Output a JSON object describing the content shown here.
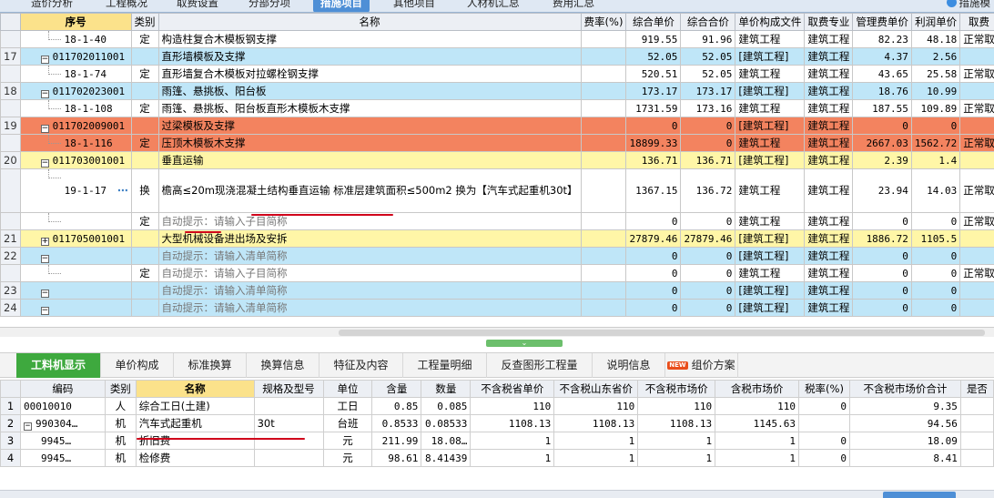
{
  "top_tabs": [
    "造价分析",
    "工程概况",
    "取费设置",
    "分部分项",
    "措施项目",
    "其他项目",
    "人材机汇总",
    "费用汇总"
  ],
  "top_tab_active": 4,
  "top_right_label": "措施模",
  "grid": {
    "headers": [
      "",
      "序号",
      "类别",
      "名称",
      "费率(%)",
      "综合单价",
      "综合合价",
      "单价构成文件",
      "取费专业",
      "管理费单价",
      "利润单价",
      "取费"
    ],
    "rows": [
      {
        "rn": "",
        "code": "18-1-40",
        "type": "定",
        "name": "构造柱复合木模板钢支撑",
        "rate": "",
        "unit_price": "919.55",
        "total": "91.96",
        "doc": "建筑工程",
        "spec": "建筑工程",
        "mgmt": "82.23",
        "profit": "48.18",
        "fee": "正常取"
      },
      {
        "rn": "17",
        "code": "011702011001",
        "type": "",
        "name": "直形墙模板及支撑",
        "rate": "",
        "unit_price": "52.05",
        "total": "52.05",
        "doc": "[建筑工程]",
        "spec": "建筑工程",
        "mgmt": "4.37",
        "profit": "2.56",
        "fee": ""
      },
      {
        "rn": "",
        "code": "18-1-74",
        "type": "定",
        "name": "直形墙复合木模板对拉螺栓钢支撑",
        "rate": "",
        "unit_price": "520.51",
        "total": "52.05",
        "doc": "建筑工程",
        "spec": "建筑工程",
        "mgmt": "43.65",
        "profit": "25.58",
        "fee": "正常取"
      },
      {
        "rn": "18",
        "code": "011702023001",
        "type": "",
        "name": "雨篷、悬挑板、阳台板",
        "rate": "",
        "unit_price": "173.17",
        "total": "173.17",
        "doc": "[建筑工程]",
        "spec": "建筑工程",
        "mgmt": "18.76",
        "profit": "10.99",
        "fee": ""
      },
      {
        "rn": "",
        "code": "18-1-108",
        "type": "定",
        "name": "雨篷、悬挑板、阳台板直形木模板木支撑",
        "rate": "",
        "unit_price": "1731.59",
        "total": "173.16",
        "doc": "建筑工程",
        "spec": "建筑工程",
        "mgmt": "187.55",
        "profit": "109.89",
        "fee": "正常取"
      },
      {
        "rn": "19",
        "code": "011702009001",
        "type": "",
        "name": "过梁模板及支撑",
        "rate": "",
        "unit_price": "0",
        "total": "0",
        "doc": "[建筑工程]",
        "spec": "建筑工程",
        "mgmt": "0",
        "profit": "0",
        "fee": ""
      },
      {
        "rn": "",
        "code": "18-1-116",
        "type": "定",
        "name": "压顶木模板木支撑",
        "rate": "",
        "unit_price": "18899.33",
        "total": "0",
        "doc": "建筑工程",
        "spec": "建筑工程",
        "mgmt": "2667.03",
        "profit": "1562.72",
        "fee": "正常取"
      },
      {
        "rn": "20",
        "code": "011703001001",
        "type": "",
        "name": "垂直运输",
        "rate": "",
        "unit_price": "136.71",
        "total": "136.71",
        "doc": "[建筑工程]",
        "spec": "建筑工程",
        "mgmt": "2.39",
        "profit": "1.4",
        "fee": ""
      },
      {
        "rn": "",
        "code": "19-1-17",
        "type": "换",
        "name": "檐高≤20m现浇混凝土结构垂直运输 标准层建筑面积≤500m2  换为【汽车式起重机30t】",
        "rate": "",
        "unit_price": "1367.15",
        "total": "136.72",
        "doc": "建筑工程",
        "spec": "建筑工程",
        "mgmt": "23.94",
        "profit": "14.03",
        "fee": "正常取"
      },
      {
        "rn": "",
        "code": "",
        "type": "定",
        "name": "自动提示：请输入子目简称",
        "rate": "",
        "unit_price": "0",
        "total": "0",
        "doc": "建筑工程",
        "spec": "建筑工程",
        "mgmt": "0",
        "profit": "0",
        "fee": "正常取"
      },
      {
        "rn": "21",
        "code": "011705001001",
        "type": "",
        "name": "大型机械设备进出场及安拆",
        "rate": "",
        "unit_price": "27879.46",
        "total": "27879.46",
        "doc": "[建筑工程]",
        "spec": "建筑工程",
        "mgmt": "1886.72",
        "profit": "1105.5",
        "fee": ""
      },
      {
        "rn": "22",
        "code": "",
        "type": "",
        "name": "自动提示：请输入清单简称",
        "rate": "",
        "unit_price": "0",
        "total": "0",
        "doc": "[建筑工程]",
        "spec": "建筑工程",
        "mgmt": "0",
        "profit": "0",
        "fee": ""
      },
      {
        "rn": "",
        "code": "",
        "type": "定",
        "name": "自动提示：请输入子目简称",
        "rate": "",
        "unit_price": "0",
        "total": "0",
        "doc": "建筑工程",
        "spec": "建筑工程",
        "mgmt": "0",
        "profit": "0",
        "fee": "正常取"
      },
      {
        "rn": "23",
        "code": "",
        "type": "",
        "name": "自动提示：请输入清单简称",
        "rate": "",
        "unit_price": "0",
        "total": "0",
        "doc": "[建筑工程]",
        "spec": "建筑工程",
        "mgmt": "0",
        "profit": "0",
        "fee": ""
      },
      {
        "rn": "24",
        "code": "",
        "type": "",
        "name": "自动提示：请输入清单简称",
        "rate": "",
        "unit_price": "0",
        "total": "0",
        "doc": "[建筑工程]",
        "spec": "建筑工程",
        "mgmt": "0",
        "profit": "0",
        "fee": ""
      }
    ]
  },
  "bottom_tabs": [
    "工料机显示",
    "单价构成",
    "标准换算",
    "换算信息",
    "特征及内容",
    "工程量明细",
    "反查图形工程量",
    "说明信息",
    "组价方案"
  ],
  "new_badge": "NEW",
  "sub": {
    "headers": [
      "",
      "编码",
      "类别",
      "名称",
      "规格及型号",
      "单位",
      "含量",
      "数量",
      "不含税省单价",
      "不含税山东省价",
      "不含税市场价",
      "含税市场价",
      "税率(%)",
      "不含税市场价合计",
      "是否"
    ],
    "rows": [
      {
        "rn": "1",
        "code": "00010010",
        "type": "人",
        "name": "综合工日(土建)",
        "spec": "",
        "unit": "工日",
        "qty_per": "0.85",
        "qty": "0.085",
        "p1": "110",
        "p2": "110",
        "p3": "110",
        "p4": "110",
        "tax": "0",
        "sum": "9.35"
      },
      {
        "rn": "2",
        "code": "990304…",
        "type": "机",
        "name": "汽车式起重机",
        "spec": "30t",
        "unit": "台班",
        "qty_per": "0.8533",
        "qty": "0.08533",
        "p1": "1108.13",
        "p2": "1108.13",
        "p3": "1108.13",
        "p4": "1145.63",
        "tax": "",
        "sum": "94.56"
      },
      {
        "rn": "3",
        "code": "9945…",
        "type": "机",
        "name": "折旧费",
        "spec": "",
        "unit": "元",
        "qty_per": "211.99",
        "qty": "18.08…",
        "p1": "1",
        "p2": "1",
        "p3": "1",
        "p4": "1",
        "tax": "0",
        "sum": "18.09"
      },
      {
        "rn": "4",
        "code": "9945…",
        "type": "机",
        "name": "检修费",
        "spec": "",
        "unit": "元",
        "qty_per": "98.61",
        "qty": "8.41439",
        "p1": "1",
        "p2": "1",
        "p3": "1",
        "p4": "1",
        "tax": "0",
        "sum": "8.41"
      }
    ]
  }
}
